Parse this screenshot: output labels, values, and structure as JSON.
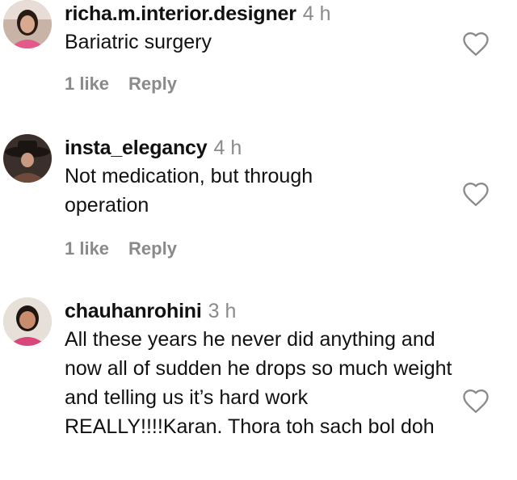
{
  "comments": [
    {
      "username": "richa.m.interior.designer",
      "time": "4 h",
      "text": "Bariatric surgery",
      "likes": "1 like",
      "reply": "Reply",
      "avatar_icon": "user-avatar"
    },
    {
      "username": "insta_elegancy",
      "time": "4 h",
      "text": "Not medication, but through operation",
      "likes": "1 like",
      "reply": "Reply",
      "avatar_icon": "user-avatar"
    },
    {
      "username": "chauhanrohini",
      "time": "3 h",
      "text": "All these years he never did anything and now all of sudden he drops so much weight and telling us it’s hard work REALLY!!!!Karan. Thora toh sach bol doh",
      "likes": "",
      "reply": "",
      "avatar_icon": "user-avatar"
    }
  ],
  "icons": {
    "like": "heart-outline-icon"
  },
  "colors": {
    "text": "#111111",
    "muted": "#8a8a8a",
    "background": "#ffffff"
  }
}
